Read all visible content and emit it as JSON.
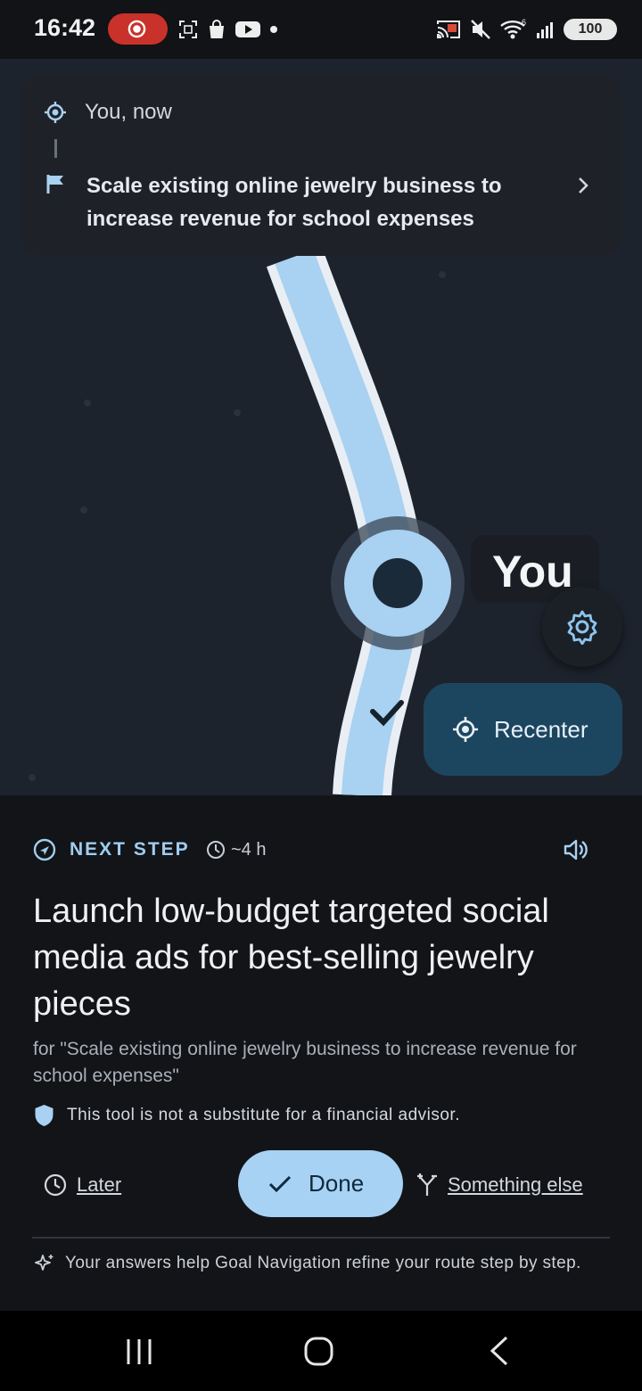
{
  "status_bar": {
    "time": "16:42",
    "battery": "100",
    "left_icons": [
      "screen-record-icon",
      "screenshot-icon",
      "shopping-bag-icon",
      "youtube-icon",
      "dot-icon"
    ],
    "right_icons": [
      "cast-icon",
      "mute-icon",
      "wifi-icon",
      "signal-icon",
      "battery-icon"
    ]
  },
  "route_card": {
    "origin": "You, now",
    "goal": "Scale existing online jewelry business to increase revenue for school expenses"
  },
  "map": {
    "you_label": "You",
    "recenter_label": "Recenter"
  },
  "next_step": {
    "label": "NEXT STEP",
    "duration": "~4 h",
    "title": "Launch low-budget targeted social media ads for best-selling jewelry pieces",
    "for_text": "for \"Scale existing online jewelry business to increase revenue for school expenses\"",
    "disclaimer": "This tool is not a substitute for a financial advisor."
  },
  "actions": {
    "later": "Later",
    "done": "Done",
    "something_else": "Something else"
  },
  "footnote": "Your answers help Goal Navigation refine your route step by step.",
  "colors": {
    "accent": "#a7d2f4",
    "recenter_bg": "#1c4660",
    "background": "#121418",
    "map_bg": "#1d232d",
    "record_pill": "#c9312b"
  }
}
